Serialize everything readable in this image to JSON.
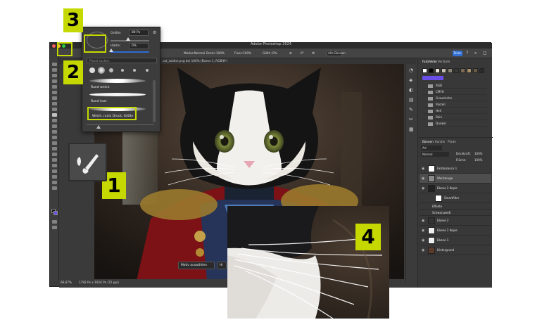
{
  "app": {
    "window_title": "Adobe Photoshop 2024",
    "doc_tab": "cat_soldier.png bei 100% (Ebene 1, RGB/8*)",
    "share_button": "Teilen"
  },
  "options_bar": {
    "brush_size_value": "80",
    "mode_label": "Modus:",
    "mode_value": "Normal",
    "opacity_label": "Deckr.:",
    "opacity_value": "100%",
    "flow_label": "Fluss:",
    "flow_value": "100%",
    "smoothing_label": "Glätt.:",
    "smoothing_value": "0%",
    "angle_value": "0°",
    "all_layers": "Alle Ebenen"
  },
  "brush_popup": {
    "size_label": "Größe:",
    "size_value": "80 Px",
    "hardness_label": "Härte:",
    "hardness_value": "0%",
    "search_placeholder": "Pinsel suchen",
    "brush_items": [
      "Rund weich",
      "Rund hart",
      "Weich, rund, Druck, Größe"
    ]
  },
  "callouts": {
    "one": "1",
    "two": "2",
    "three": "3",
    "four": "4"
  },
  "status_bar": {
    "zoom": "66,67%",
    "doc_info": "1792 Px x 1024 Px (72 ppi)"
  },
  "floating_bar": {
    "select_subject": "Motiv auswählen",
    "remove_bg": "Hi"
  },
  "swatches_panel": {
    "tabs": [
      "Farbfelder",
      "Verläufe"
    ],
    "colors": [
      "#ffffff",
      "#000000",
      "#e8e2d6",
      "#c7c0b2",
      "#8c8576",
      "#3c3a36",
      "#7a6a54",
      "#a78e6a",
      "#6b5a48",
      "#2b2b2b"
    ],
    "accent_color": "#6b4ee8",
    "folders": [
      "RGB",
      "CMYK",
      "Graustufen",
      "Pastell",
      "Hell",
      "Rein",
      "Dunkel"
    ]
  },
  "layers_panel": {
    "tabs": [
      "Ebenen",
      "Kanäle",
      "Pfade"
    ],
    "kind_label": "Art",
    "blend_mode": "Normal",
    "opacity_label": "Deckkraft:",
    "opacity_value": "100%",
    "fill_label": "Fläche:",
    "fill_value": "100%",
    "layers": [
      "Farbbalance 1",
      "Werkzeuge",
      "Ebene 2 Kopie",
      "Smartfilter",
      "Effekte",
      "Schwarzweiß",
      "Ebene 2",
      "Ebene 1 Kopie",
      "Ebene 1",
      "Hintergrund"
    ]
  },
  "colors": {
    "callout": "#c5d900",
    "accent": "#2f6fd6"
  }
}
